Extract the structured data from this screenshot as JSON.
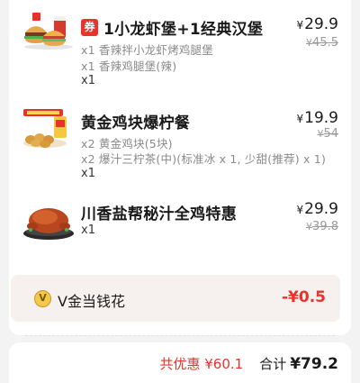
{
  "items": [
    {
      "coupon_tag": "券",
      "name": "1小龙虾堡+1经典汉堡",
      "price": "29.9",
      "original_price": "45.5",
      "details": [
        "x1 香辣拌小龙虾烤鸡腿堡",
        "x1 香辣鸡腿堡(辣)"
      ],
      "quantity": "x1",
      "image": "burger-combo-image"
    },
    {
      "name": "黄金鸡块爆柠餐",
      "price": "19.9",
      "original_price": "54",
      "details": [
        "x2 黄金鸡块(5块)",
        "x2 爆汁三柠茶(中)(标准冰 x 1, 少甜(推荐) x 1)"
      ],
      "quantity": "x1",
      "image": "nuggets-lemon-tea-image"
    },
    {
      "name": "川香盐帮秘汁全鸡特惠",
      "price": "29.9",
      "original_price": "39.8",
      "details": [],
      "quantity": "x1",
      "image": "whole-roast-chicken-image"
    }
  ],
  "currency_symbol": "¥",
  "v_coin": {
    "icon": "v-coin-icon",
    "icon_letter": "V",
    "label": "V金当钱花",
    "amount": "-¥0.5"
  },
  "footer": {
    "discount_text": "共优惠 ¥60.1",
    "total_label": "合计",
    "total_value": "¥79.2"
  },
  "colors": {
    "accent_red": "#e8332b",
    "v_card_bg": "#f6f0ee",
    "coin_gold": "#f2c94c"
  }
}
